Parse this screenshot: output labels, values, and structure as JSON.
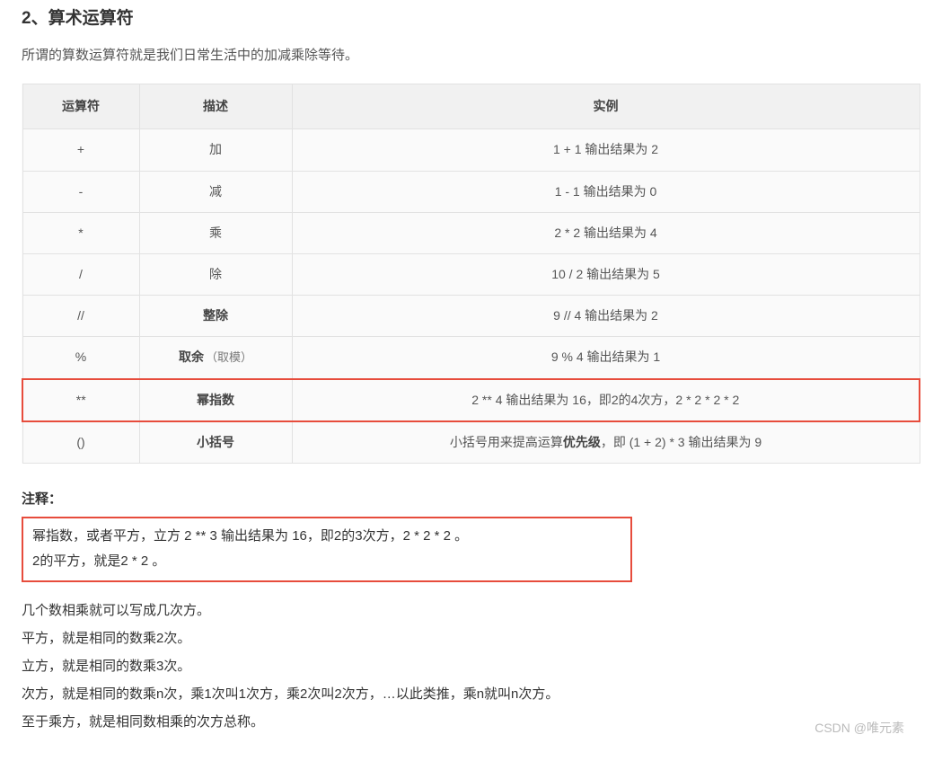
{
  "section": {
    "heading": "2、算术运算符",
    "intro": "所谓的算数运算符就是我们日常生活中的加减乘除等待。"
  },
  "table": {
    "headers": {
      "op": "运算符",
      "desc": "描述",
      "example": "实例"
    },
    "rows": [
      {
        "op": "+",
        "desc": "加",
        "desc_note": "",
        "example": "1 + 1 输出结果为 2",
        "bold": false,
        "highlight": false
      },
      {
        "op": "-",
        "desc": "减",
        "desc_note": "",
        "example": "1 - 1 输出结果为 0",
        "bold": false,
        "highlight": false
      },
      {
        "op": "*",
        "desc": "乘",
        "desc_note": "",
        "example": "2 * 2 输出结果为 4",
        "bold": false,
        "highlight": false
      },
      {
        "op": "/",
        "desc": "除",
        "desc_note": "",
        "example": "10 / 2 输出结果为 5",
        "bold": false,
        "highlight": false
      },
      {
        "op": "//",
        "desc": "整除",
        "desc_note": "",
        "example": "9 // 4 输出结果为 2",
        "bold": true,
        "highlight": false
      },
      {
        "op": "%",
        "desc": "取余",
        "desc_note": "（取模）",
        "example": "9 % 4 输出结果为 1",
        "bold": true,
        "highlight": false
      },
      {
        "op": "**",
        "desc": "幂指数",
        "desc_note": "",
        "example": "2 ** 4 输出结果为 16，即2的4次方，2 * 2 * 2 * 2",
        "bold": true,
        "highlight": true
      },
      {
        "op": "()",
        "desc": "小括号",
        "desc_note": "",
        "example_pre": "小括号用来提高运算",
        "example_bold": "优先级",
        "example_post": "，即 (1 + 2) * 3 输出结果为 9",
        "bold": true,
        "highlight": false
      }
    ]
  },
  "notes": {
    "heading": "注释：",
    "box_line1": "幂指数，或者平方，立方 2 ** 3 输出结果为 16，即2的3次方，2 * 2 * 2 。",
    "box_line2": "2的平方，就是2 * 2 。",
    "paras": [
      "几个数相乘就可以写成几次方。",
      "平方，就是相同的数乘2次。",
      "立方，就是相同的数乘3次。",
      "次方，就是相同的数乘n次，乘1次叫1次方，乘2次叫2次方，…以此类推，乘n就叫n次方。",
      "至于乘方，就是相同数相乘的次方总称。"
    ]
  },
  "watermark": "CSDN @唯元素"
}
